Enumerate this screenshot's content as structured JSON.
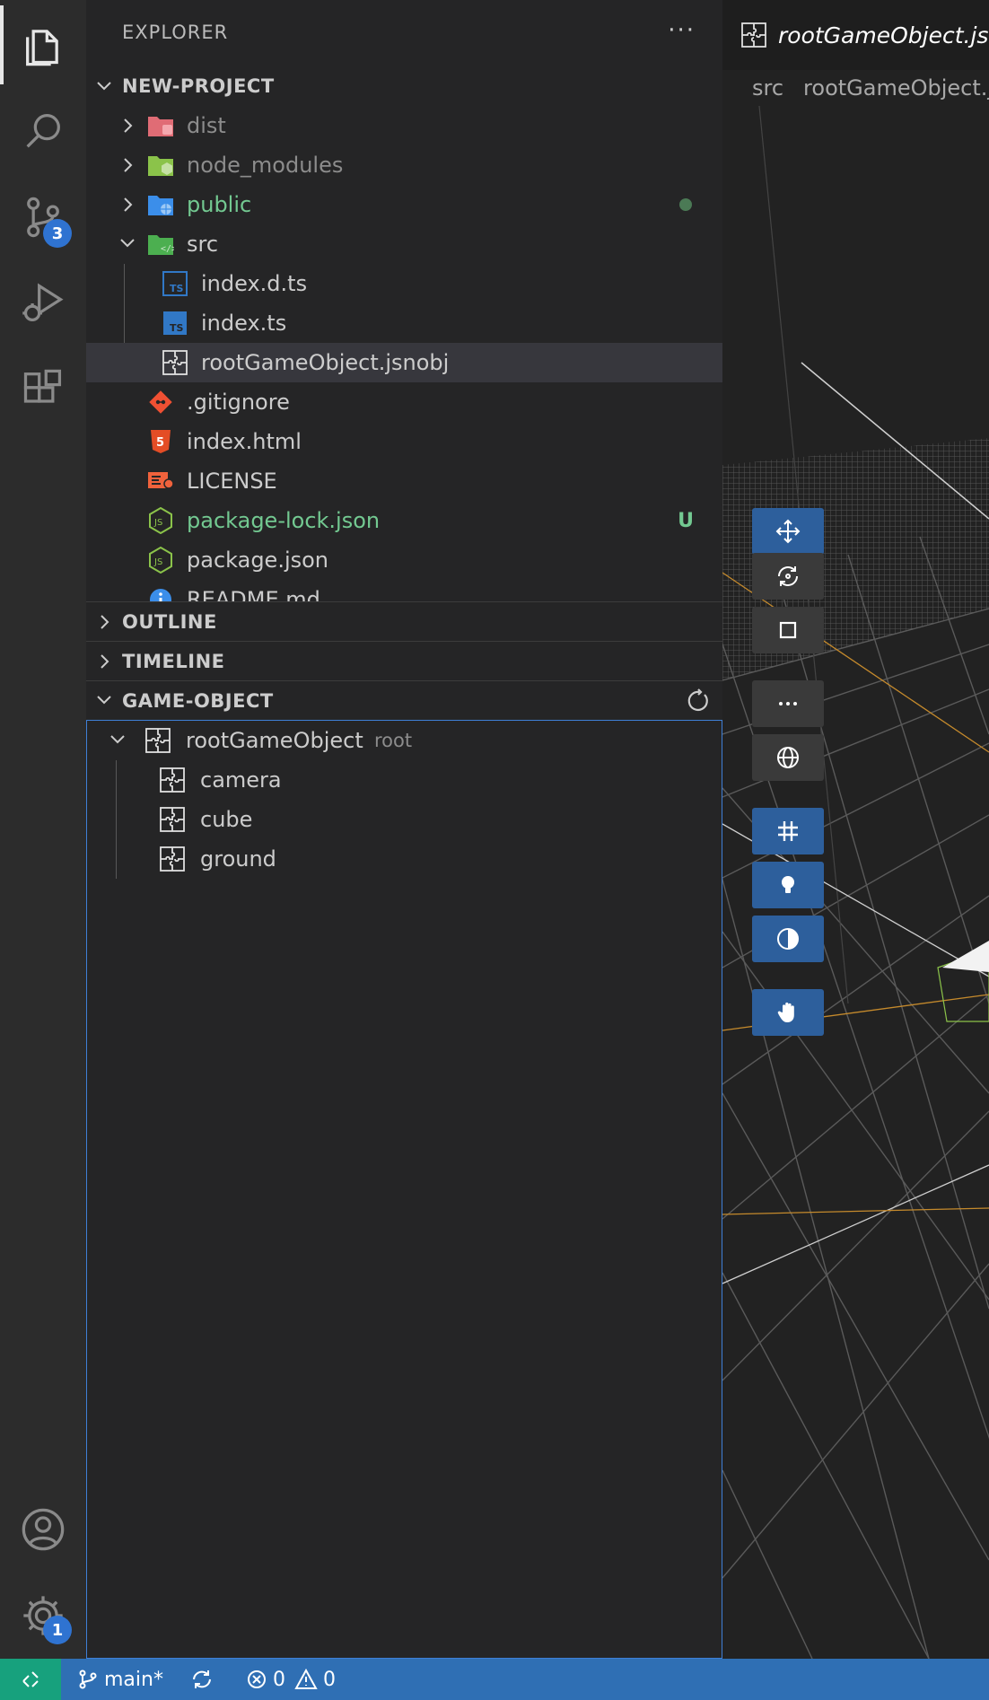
{
  "activity_bar": {
    "items": [
      {
        "name": "explorer",
        "icon": "files-icon"
      },
      {
        "name": "search",
        "icon": "search-icon"
      },
      {
        "name": "source-control",
        "icon": "source-control-icon",
        "badge": "3"
      },
      {
        "name": "run-debug",
        "icon": "run-debug-icon"
      },
      {
        "name": "extensions",
        "icon": "extensions-icon"
      }
    ],
    "bottom": [
      {
        "name": "accounts",
        "icon": "account-icon"
      },
      {
        "name": "manage",
        "icon": "gear-icon",
        "badge": "1"
      }
    ]
  },
  "sidebar": {
    "title": "EXPLORER",
    "more": "···",
    "project": "NEW-PROJECT",
    "files": [
      {
        "label": "dist",
        "color": "#8c8c8c",
        "icon": "folder-dist-icon",
        "collapsed": true
      },
      {
        "label": "node_modules",
        "color": "#8c8c8c",
        "icon": "folder-node-icon",
        "collapsed": true
      },
      {
        "label": "public",
        "color": "#73c991",
        "icon": "folder-public-icon",
        "collapsed": true,
        "dot": true
      },
      {
        "label": "src",
        "color": "#cccccc",
        "icon": "folder-src-icon",
        "collapsed": false
      },
      {
        "label": "index.d.ts",
        "color": "#cccccc",
        "icon": "typescript-def-icon"
      },
      {
        "label": "index.ts",
        "color": "#cccccc",
        "icon": "typescript-icon"
      },
      {
        "label": "rootGameObject.jsnobj",
        "color": "#cccccc",
        "icon": "gameobject-icon",
        "selected": true
      },
      {
        "label": ".gitignore",
        "color": "#cccccc",
        "icon": "git-icon"
      },
      {
        "label": "index.html",
        "color": "#cccccc",
        "icon": "html-icon"
      },
      {
        "label": "LICENSE",
        "color": "#cccccc",
        "icon": "license-icon"
      },
      {
        "label": "package-lock.json",
        "color": "#73c991",
        "icon": "nodejs-icon",
        "tag": "U"
      },
      {
        "label": "package.json",
        "color": "#cccccc",
        "icon": "nodejs-icon"
      },
      {
        "label": "README.md",
        "color": "#cccccc",
        "icon": "info-icon"
      }
    ],
    "outline": "OUTLINE",
    "timeline": "TIMELINE",
    "game_object": {
      "title": "GAME-OBJECT",
      "root_label": "rootGameObject",
      "root_desc": "root",
      "children": [
        "camera",
        "cube",
        "ground"
      ]
    }
  },
  "editor": {
    "tab_title": "rootGameObject.jsnobj",
    "breadcrumb": [
      "src",
      "rootGameObject.jsnobj"
    ],
    "tools": [
      {
        "name": "move-tool",
        "icon": "move-icon",
        "active": true
      },
      {
        "name": "rotate-tool",
        "icon": "rotate-icon",
        "active": false
      },
      {
        "name": "scale-tool",
        "icon": "square-icon",
        "active": false
      },
      {
        "name": "more-tool",
        "icon": "ellipsis-icon",
        "active": false
      },
      {
        "name": "world-space-tool",
        "icon": "globe-icon",
        "active": false
      },
      {
        "name": "grid-toggle",
        "icon": "grid-icon",
        "active": true
      },
      {
        "name": "light-toggle",
        "icon": "lightbulb-icon",
        "active": true
      },
      {
        "name": "contrast-toggle",
        "icon": "contrast-icon",
        "active": true
      },
      {
        "name": "pan-tool",
        "icon": "hand-icon",
        "active": true
      }
    ]
  },
  "status_bar": {
    "branch": "main*",
    "errors": "0",
    "warnings": "0"
  },
  "colors": {
    "accent": "#2f6fb4",
    "remote": "#17a17d",
    "untracked": "#73c991",
    "tool_active": "#2d5f9c"
  }
}
